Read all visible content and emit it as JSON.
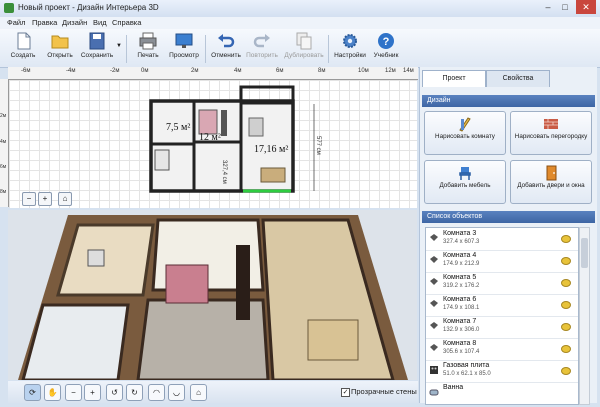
{
  "window": {
    "title": "Новый проект - Дизайн Интерьера 3D"
  },
  "menu": [
    "Файл",
    "Правка",
    "Дизайн",
    "Вид",
    "Справка"
  ],
  "toolbar": {
    "create": "Создать",
    "open": "Открыть",
    "save": "Сохранить",
    "print": "Печать",
    "preview": "Просмотр",
    "undo": "Отменить",
    "redo": "Повторить",
    "duplicate": "Дублировать",
    "settings": "Настройки",
    "tutorial": "Учебник"
  },
  "ruler": {
    "top_ticks": [
      "-6м",
      "-4м",
      "-2м",
      "0м",
      "2м",
      "4м",
      "6м",
      "8м",
      "10м",
      "12м",
      "14м"
    ],
    "left_ticks": [
      "2м",
      "4м",
      "6м",
      "8м"
    ]
  },
  "plan": {
    "room_labels": [
      "7,5 м²",
      "12 м²",
      "17,16 м²"
    ],
    "dim_vertical_left": "327,4 см",
    "dim_vertical_right": "577 см"
  },
  "options": {
    "transparent_walls": "Прозрачные стены",
    "transparent_walls_checked": true
  },
  "panel": {
    "tab_project": "Проект",
    "tab_properties": "Свойства",
    "design_header": "Дизайн",
    "draw_room": "Нарисовать комнату",
    "draw_partition": "Нарисовать перегородку",
    "add_furniture": "Добавить мебель",
    "add_doors_windows": "Добавить двери и окна",
    "objects_header": "Список объектов",
    "objects": [
      {
        "name": "Комната 3",
        "dims": "327.4 x 607.3"
      },
      {
        "name": "Комната 4",
        "dims": "174.9 x 212.9"
      },
      {
        "name": "Комната 5",
        "dims": "319.2 x 176.2"
      },
      {
        "name": "Комната 6",
        "dims": "174.9 x 108.1"
      },
      {
        "name": "Комната 7",
        "dims": "132.9 x 306.0"
      },
      {
        "name": "Комната 8",
        "dims": "305.6 x 107.4"
      },
      {
        "name": "Газовая плита",
        "dims": "51.0 x 62.1 x 85.0"
      },
      {
        "name": "Ванна",
        "dims": ""
      }
    ]
  },
  "colors": {
    "accent": "#3d65a4",
    "titlebar": "#d3e0f1"
  }
}
